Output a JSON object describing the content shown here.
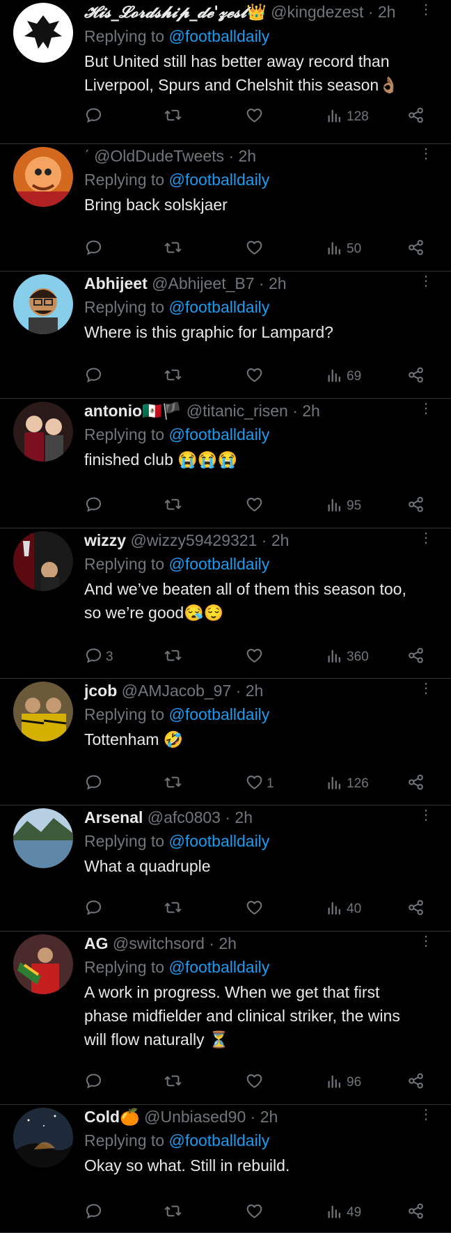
{
  "tweets": [
    {
      "display_name": "𝓗𝓲𝓼_𝓛𝓸𝓻𝓭𝓼𝓱𝓲𝓹_𝓭𝓮'𝔃𝓮𝓼𝓽",
      "name_emoji": "👑",
      "handle": "@kingdezest",
      "sep": "·",
      "time": "2h",
      "replying_prefix": "Replying to ",
      "replying_to": "@footballdaily",
      "text": "But United still has better away record than Liverpool, Spurs and Chelshit this season👌🏽",
      "reply_count": "",
      "like_count": "",
      "views": "128",
      "avatar_icon": "eagle-logo-icon"
    },
    {
      "display_name": "",
      "name_emoji": "ˊ",
      "handle": "@OldDudeTweets",
      "sep": "·",
      "time": "2h",
      "replying_prefix": "Replying to ",
      "replying_to": "@footballdaily",
      "text": "Bring back solskjaer",
      "reply_count": "",
      "like_count": "",
      "views": "50",
      "avatar_icon": "cartoon-portrait-icon"
    },
    {
      "display_name": "Abhijeet",
      "name_emoji": "",
      "handle": "@Abhijeet_B7",
      "sep": "·",
      "time": "2h",
      "replying_prefix": "Replying to ",
      "replying_to": "@footballdaily",
      "text": "Where is this graphic for Lampard?",
      "reply_count": "",
      "like_count": "",
      "views": "69",
      "avatar_icon": "memoji-avatar-icon"
    },
    {
      "display_name": "antonio",
      "name_emoji": "🇲🇽🏴",
      "handle": "@titanic_risen",
      "sep": "·",
      "time": "2h",
      "replying_prefix": "Replying to ",
      "replying_to": "@footballdaily",
      "text": "finished club 😭😭😭",
      "reply_count": "",
      "like_count": "",
      "views": "95",
      "avatar_icon": "photo-avatar-icon"
    },
    {
      "display_name": "wizzy",
      "name_emoji": "",
      "handle": "@wizzy59429321",
      "sep": "·",
      "time": "2h",
      "replying_prefix": "Replying to ",
      "replying_to": "@footballdaily",
      "text": "And we’ve beaten all of them this season too, so we’re good😪😌",
      "reply_count": "3",
      "like_count": "",
      "views": "360",
      "avatar_icon": "trophy-photo-icon"
    },
    {
      "display_name": "jcob",
      "name_emoji": "",
      "handle": "@AMJacob_97",
      "sep": "·",
      "time": "2h",
      "replying_prefix": "Replying to ",
      "replying_to": "@footballdaily",
      "text": "Tottenham 🤣",
      "reply_count": "",
      "like_count": "1",
      "views": "126",
      "avatar_icon": "group-photo-icon"
    },
    {
      "display_name": "Arsenal",
      "name_emoji": "",
      "handle": "@afc0803",
      "sep": "·",
      "time": "2h",
      "replying_prefix": "Replying to ",
      "replying_to": "@footballdaily",
      "text": "What a quadruple",
      "reply_count": "",
      "like_count": "",
      "views": "40",
      "avatar_icon": "landscape-photo-icon"
    },
    {
      "display_name": "AG",
      "name_emoji": "",
      "handle": "@switchsord",
      "sep": "·",
      "time": "2h",
      "replying_prefix": "Replying to ",
      "replying_to": "@footballdaily",
      "text": "A work in progress. When we get that first phase midfielder and clinical striker, the wins will flow naturally ⏳",
      "reply_count": "",
      "like_count": "",
      "views": "96",
      "avatar_icon": "fan-photo-icon"
    },
    {
      "display_name": "Cold",
      "name_emoji": "🍊",
      "handle": "@Unbiased90",
      "sep": "·",
      "time": "2h",
      "replying_prefix": "Replying to ",
      "replying_to": "@footballdaily",
      "text": "Okay so what. Still in rebuild.",
      "reply_count": "",
      "like_count": "",
      "views": "49",
      "avatar_icon": "night-sky-photo-icon"
    }
  ],
  "colors": {
    "background": "#000000",
    "text": "#e7e9ea",
    "muted": "#71767b",
    "link": "#1d9bf0",
    "divider": "#2f3336"
  }
}
